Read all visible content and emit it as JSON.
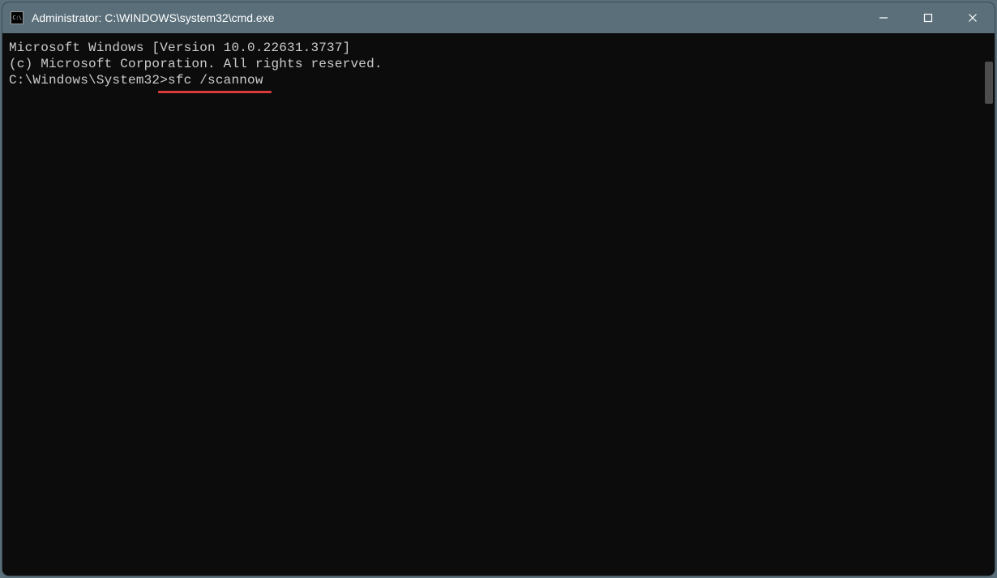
{
  "titlebar": {
    "icon_label": "C:\\",
    "title": "Administrator: C:\\WINDOWS\\system32\\cmd.exe"
  },
  "terminal": {
    "line1": "Microsoft Windows [Version 10.0.22631.3737]",
    "line2": "(c) Microsoft Corporation. All rights reserved.",
    "blank": "",
    "prompt": "C:\\Windows\\System32>",
    "command": "sfc /scannow"
  },
  "annotation": {
    "underline_color": "#d93a3a"
  }
}
